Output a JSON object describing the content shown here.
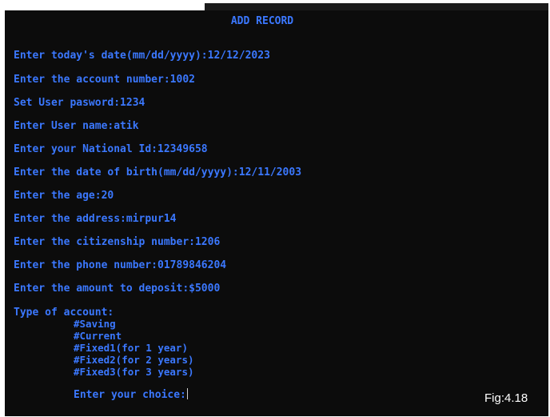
{
  "title": "ADD RECORD",
  "prompts": [
    "Enter today's date(mm/dd/yyyy):12/12/2023",
    "Enter the account number:1002",
    "Set User pasword:1234",
    "Enter User name:atik",
    "Enter your National Id:12349658",
    "Enter the date of birth(mm/dd/yyyy):12/11/2003",
    "Enter the age:20",
    "Enter the address:mirpur14",
    "Enter the citizenship number:1206",
    "Enter the phone number:01789846204",
    "Enter the amount to deposit:$5000"
  ],
  "account_type": {
    "label": "Type of account:",
    "options": [
      "#Saving",
      "#Current",
      "#Fixed1(for 1 year)",
      "#Fixed2(for 2 years)",
      "#Fixed3(for 3 years)"
    ]
  },
  "choice_prompt": "Enter your choice:",
  "caption": "Fig:4.18",
  "colors": {
    "background": "#0c0c0c",
    "text": "#3b78ff",
    "caption": "#ffffff"
  }
}
